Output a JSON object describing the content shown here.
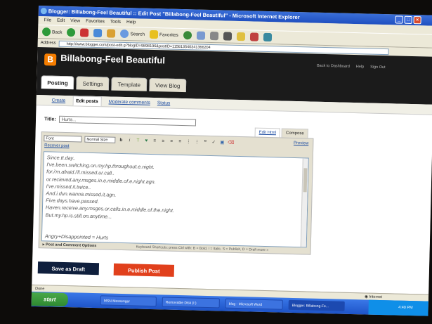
{
  "window": {
    "title": "Blogger: Billabong-Feel Beautiful :: Edit Post \"Billabong-Feel Beautiful\" - Microsoft Internet Explorer"
  },
  "menu": [
    "File",
    "Edit",
    "View",
    "Favorites",
    "Tools",
    "Help"
  ],
  "toolbar": {
    "back_label": "Back",
    "search_label": "Search",
    "favorites_label": "Favorites"
  },
  "address": {
    "label": "Address",
    "url": "http://www.blogger.com/post-edit.g?blogID=9898196&postID=115813540341366204"
  },
  "blogger": {
    "logo_letter": "B",
    "blog_name": "Billabong-Feel Beautiful",
    "links": [
      "Back to Dashboard",
      "Help",
      "Sign Out"
    ],
    "tabs": [
      "Posting",
      "Settings",
      "Template",
      "View Blog"
    ],
    "subtabs": [
      "Create",
      "Edit posts",
      "Moderate comments",
      "Status"
    ]
  },
  "post": {
    "title_label": "Title:",
    "title_value": "Hurts...",
    "mode_tabs": [
      "Edit Html",
      "Compose"
    ],
    "font_select": "Font",
    "size_select": "Normal Size",
    "preview_label": "Preview",
    "recover_label": "Recover post",
    "body_lines": [
      "Since.tt.day..",
      "I've.been.switching.on.my.hp.throughout.e.night.",
      "for.i'm.afraid.i'll.missed.ur.call..",
      "or.recieved.any.msges.in.e.middle.of.e.night.agn.",
      "I've.missed.it.twice..",
      "And.i.dun.wanna.missed.it.agn.",
      "Five.days.have.passed.",
      "Haven.receive.any.msges.or.calls.in.e.middle.of.the.night.",
      "But.my.hp.is.still.on.anytime...",
      "",
      "",
      "Angry+Disappointed = Hurts"
    ],
    "options_label": "Post and Comment Options",
    "shortcuts": "Keyboard Shortcuts: press Ctrl with: B = Bold, I = Italic, S = Publish, D = Draft   more »"
  },
  "buttons": {
    "save_draft": "Save as Draft",
    "publish": "Publish Post"
  },
  "status": {
    "left": "Done",
    "zone": "Internet"
  },
  "taskbar": {
    "start": "start",
    "items": [
      "MSN Messenger",
      "Removable Disk (I:)",
      "blog - Microsoft Word",
      "Blogger: Billabong-Fe..."
    ],
    "clock": "4:40 PM"
  }
}
